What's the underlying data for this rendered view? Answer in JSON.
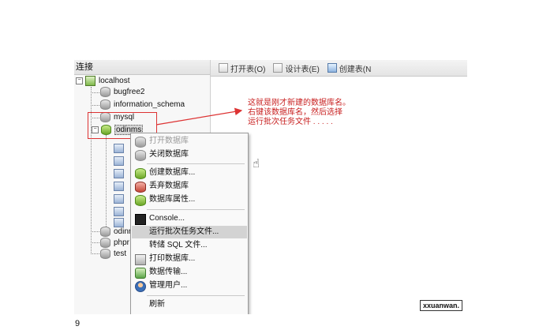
{
  "left_pane": {
    "header": "连接",
    "tree": {
      "server": "localhost",
      "databases": [
        "bugfree2",
        "information_schema",
        "mysql",
        "odinms",
        "odinr",
        "phpr",
        "test"
      ]
    }
  },
  "toolbar": {
    "open_table": "打开表(O)",
    "design_table": "设计表(E)",
    "create_table": "创建表(N"
  },
  "annotation": {
    "line1": "这就是刚才新建的数据库名。",
    "line2": "右键该数据库名，然后选择",
    "line3": "运行批次任务文件 . . . . ."
  },
  "context_menu": {
    "items": [
      {
        "label": "打开数据库",
        "icon": "database-icon",
        "disabled": true
      },
      {
        "label": "关闭数据库",
        "icon": "database-icon"
      },
      {
        "label": "创建数据库...",
        "icon": "database-add-icon"
      },
      {
        "label": "丢弃数据库",
        "icon": "database-delete-icon"
      },
      {
        "label": "数据库属性...",
        "icon": "database-properties-icon"
      },
      {
        "label": "Console...",
        "icon": "console-icon"
      },
      {
        "label": "运行批次任务文件...",
        "icon": "",
        "highlighted": true
      },
      {
        "label": "转储 SQL 文件...",
        "icon": ""
      },
      {
        "label": "打印数据库...",
        "icon": "print-icon"
      },
      {
        "label": "数据传输...",
        "icon": "transfer-icon"
      },
      {
        "label": "管理用户...",
        "icon": "user-icon"
      },
      {
        "label": "刷新",
        "icon": ""
      }
    ]
  },
  "watermark": "xxuanwan.",
  "page_number": "9",
  "colors": {
    "annotation": "#c82020",
    "highlight": "#d3d3d3"
  }
}
